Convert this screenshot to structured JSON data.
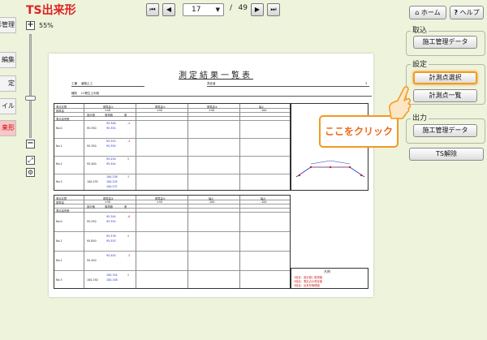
{
  "app": {
    "title": "TS出来形"
  },
  "nav": {
    "first_icon": "⏮",
    "prev_icon": "◀",
    "next_icon": "▶",
    "last_icon": "⏭",
    "page_current": "17",
    "page_select_chevron": "▼",
    "page_separator": "/",
    "page_total": "49"
  },
  "left_tabs": [
    "形管理",
    "編集",
    "定",
    "イル",
    "来形"
  ],
  "zoom": {
    "plus": "+",
    "minus": "−",
    "percent": "55%"
  },
  "document": {
    "title": "測定結果一覧表",
    "kouji_label": "工種",
    "kouji_value": "道路土工",
    "shubetsu_label": "種別",
    "shubetsu_value": "盛土",
    "kubun_label": "区別",
    "kubun_value": "LO発生土利用",
    "measure_label": "測定者",
    "page_no": "3",
    "table1": {
      "head_labels": [
        "測点区間",
        "基準高",
        "測点高低差"
      ],
      "col_groups": [
        "基準高①",
        "基準高②",
        "基準高③",
        "幅①"
      ],
      "col_groups2": [
        "±50",
        "±50",
        "±50",
        "-100"
      ],
      "sub_headers": [
        "設計値",
        "実測値",
        "差"
      ],
      "stations": [
        "No.0",
        "No.1",
        "No.2",
        "No.3"
      ],
      "blue_values": [
        "95.346",
        "95.354",
        "95.355",
        "95.350",
        "95.430",
        "95.444",
        "100.238",
        "100.245",
        "100.237"
      ],
      "black_values": [
        "95.350",
        "95.350",
        "95.400",
        "100.235"
      ],
      "red_values": [
        "-4",
        "-4",
        "5",
        "3"
      ]
    },
    "table2": {
      "head_labels": [
        "測点区間",
        "基準高",
        "測点高低差"
      ],
      "col_groups": [
        "基準高④",
        "基準高⑤",
        "幅②",
        "幅③"
      ],
      "col_groups2": [
        "±50",
        "±50",
        "-100",
        "-100"
      ],
      "sub_headers": [
        "設計値",
        "実測値",
        "差"
      ],
      "stations": [
        "No.0",
        "No.1",
        "No.2",
        "No.3"
      ],
      "blue_values": [
        "95.344",
        "95.354",
        "95.376",
        "95.555",
        "95.445",
        "100.154",
        "100.148"
      ],
      "black_values": [
        "95.250",
        "95.850",
        "95.450",
        "100.150"
      ],
      "red_values": [
        "-6",
        "5",
        "-5",
        "2"
      ]
    },
    "legend": {
      "title": "凡例",
      "lines": [
        "1段目：設計値と実測値",
        "2段目：測定点の測定値",
        "3段目：出来形管理値"
      ]
    }
  },
  "right_panel": {
    "home_label": "ホーム",
    "home_icon": "⌂",
    "help_label": "ヘルプ",
    "help_icon": "?",
    "torikomi": {
      "label": "取込",
      "btn_sekou": "施工管理データ"
    },
    "settei": {
      "label": "設定",
      "btn_keisokuten_sentaku": "計測点選択",
      "btn_keisokuten_ichiran": "計測点一覧"
    },
    "shutsuryoku": {
      "label": "出力",
      "btn_sekou": "施工管理データ"
    },
    "ts_kaijo": "TS解除"
  },
  "callout": {
    "text": "ここをクリック"
  },
  "colors": {
    "accent": "#f39a1f",
    "title_red": "#e02020",
    "background": "#eef3dc"
  }
}
